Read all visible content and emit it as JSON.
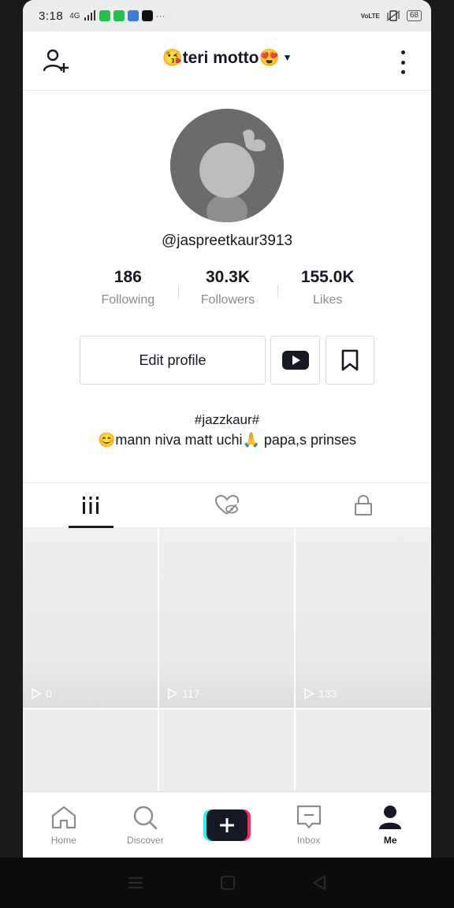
{
  "status": {
    "time": "3:18",
    "network": "4G",
    "right_label": "VoLTE",
    "battery": "68"
  },
  "header": {
    "title": "😘teri motto😍"
  },
  "profile": {
    "username": "@jaspreetkaur3913",
    "stats": [
      {
        "value": "186",
        "label": "Following"
      },
      {
        "value": "30.3K",
        "label": "Followers"
      },
      {
        "value": "155.0K",
        "label": "Likes"
      }
    ],
    "edit_label": "Edit profile",
    "bio_line1": "#jazzkaur#",
    "bio_line2": "😊mann niva matt uchi🙏 papa,s prinses"
  },
  "videos": [
    {
      "views": "0"
    },
    {
      "views": "117"
    },
    {
      "views": "133"
    }
  ],
  "nav": {
    "home": "Home",
    "discover": "Discover",
    "inbox": "Inbox",
    "me": "Me"
  },
  "colors": {
    "accent_cyan": "#25F4EE",
    "accent_red": "#FE2C55",
    "text_dark": "#161823",
    "text_gray": "#8A8B91"
  }
}
